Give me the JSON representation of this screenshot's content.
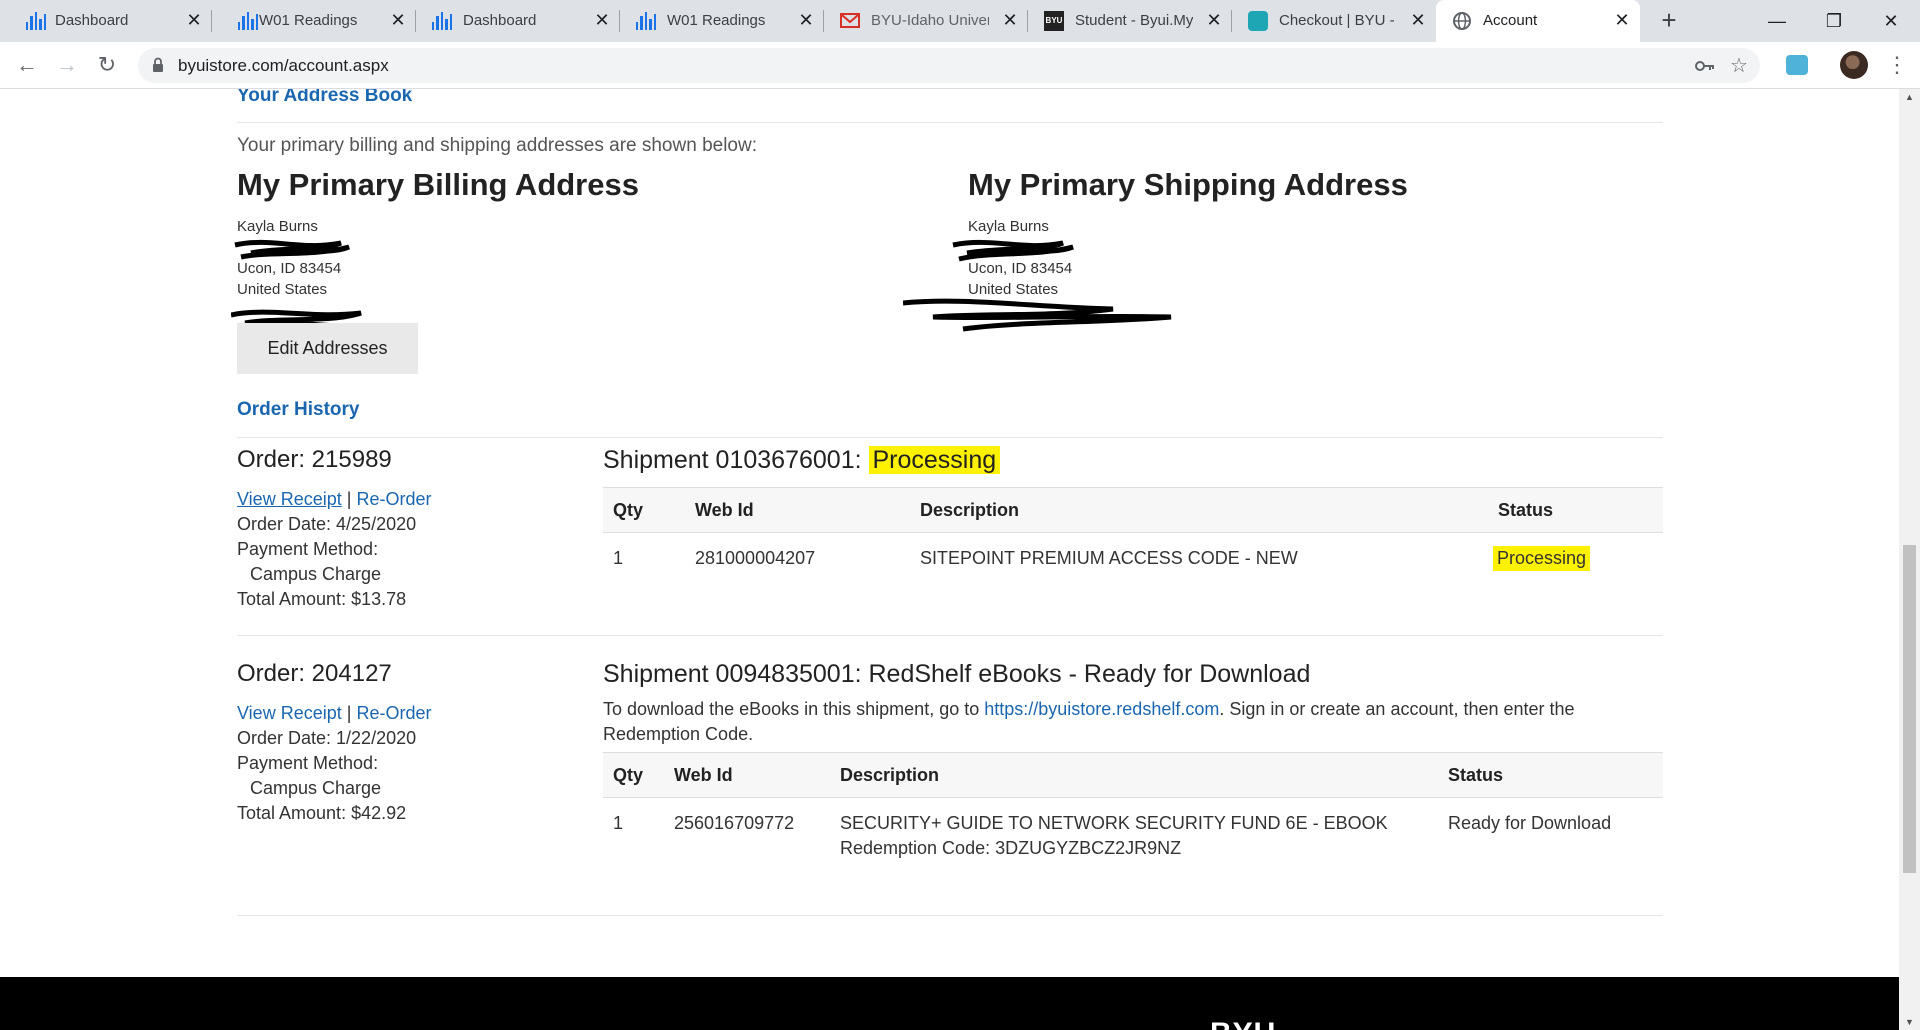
{
  "browser": {
    "tabs": [
      {
        "title": "Dashboard",
        "icon": "bars-icon"
      },
      {
        "title": "W01 Readings",
        "icon": "bars-icon"
      },
      {
        "title": "Dashboard",
        "icon": "bars-icon"
      },
      {
        "title": "W01 Readings",
        "icon": "bars-icon"
      },
      {
        "title": "BYU-Idaho Univers",
        "icon": "gmail-icon"
      },
      {
        "title": "Student - Byui.My",
        "icon": "byu-icon"
      },
      {
        "title": "Checkout | BYU - I",
        "icon": "store-icon"
      },
      {
        "title": "Account",
        "icon": "globe-icon"
      }
    ],
    "active_tab": 7,
    "url": "byuistore.com/account.aspx",
    "new_tab": "+"
  },
  "address_book": {
    "link": "Your Address Book",
    "intro": "Your primary billing and shipping addresses are shown below:",
    "billing": {
      "heading": "My Primary Billing Address",
      "name": "Kayla Burns",
      "city": "Ucon, ID 83454",
      "country": "United States"
    },
    "shipping": {
      "heading": "My Primary Shipping Address",
      "name": "Kayla Burns",
      "city": "Ucon, ID 83454",
      "country": "United States"
    },
    "edit_button": "Edit Addresses"
  },
  "order_history": {
    "link": "Order History",
    "orders": [
      {
        "order": "Order: 215989",
        "view_receipt": "View Receipt",
        "sep": "|",
        "reorder": "Re-Order",
        "date": "Order Date: 4/25/2020",
        "payment_label": "Payment Method:",
        "payment": "Campus Charge",
        "total": "Total Amount: $13.78",
        "shipment_prefix": "Shipment 0103676001:",
        "shipment_status": "Processing",
        "headers": {
          "qty": "Qty",
          "webid": "Web Id",
          "desc": "Description",
          "status": "Status"
        },
        "row": {
          "qty": "1",
          "webid": "281000004207",
          "desc": "SITEPOINT PREMIUM ACCESS CODE - NEW",
          "status": "Processing"
        }
      },
      {
        "order": "Order: 204127",
        "view_receipt": "View Receipt",
        "sep": "|",
        "reorder": "Re-Order",
        "date": "Order Date: 1/22/2020",
        "payment_label": "Payment Method:",
        "payment": "Campus Charge",
        "total": "Total Amount: $42.92",
        "shipment_title": "Shipment 0094835001: RedShelf eBooks - Ready for Download",
        "note_before": "To download the eBooks in this shipment, go to ",
        "note_link": "https://byuistore.redshelf.com",
        "note_after": ". Sign in or create an account, then enter the Redemption Code.",
        "headers": {
          "qty": "Qty",
          "webid": "Web Id",
          "desc": "Description",
          "status": "Status"
        },
        "row": {
          "qty": "1",
          "webid": "256016709772",
          "desc": "SECURITY+ GUIDE TO NETWORK SECURITY FUND 6E - EBOOK",
          "code": "Redemption Code: 3DZUGYZBCZ2JR9NZ",
          "status": "Ready for Download"
        }
      }
    ]
  },
  "footer": {
    "logo": "BYU"
  },
  "colors": {
    "link": "#1a67b0",
    "highlight": "#fff200",
    "footer": "#000000"
  }
}
